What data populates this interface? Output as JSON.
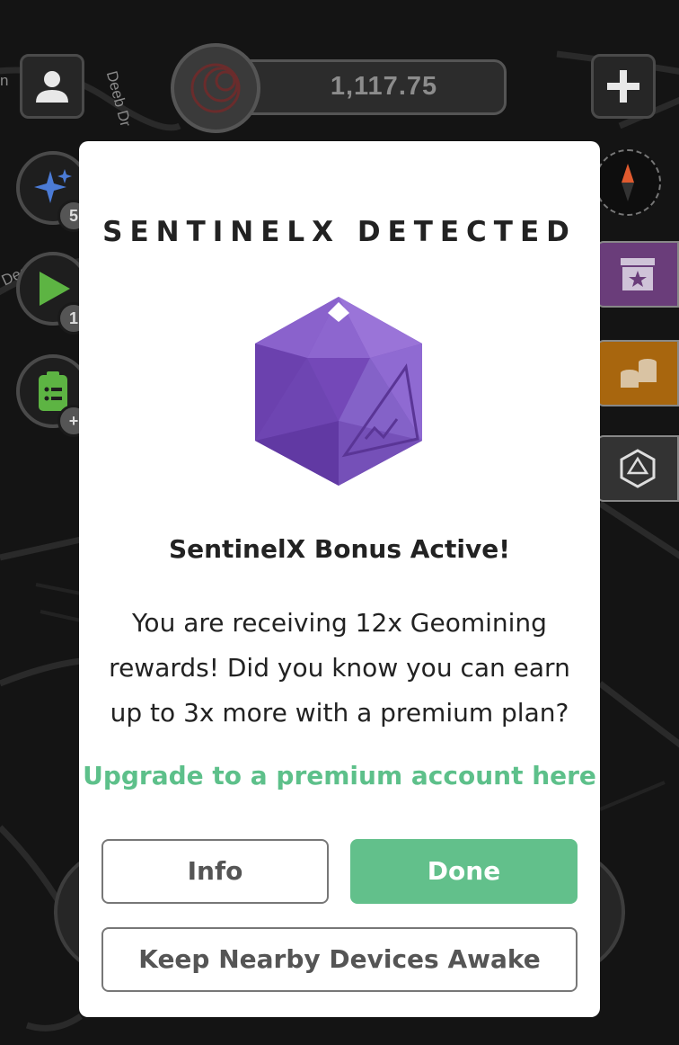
{
  "map": {
    "street_labels": [
      "n",
      "Deeb Dr",
      "Deeb Dr"
    ]
  },
  "hud": {
    "balance": "1,117.75",
    "left_badges": [
      "5",
      "1",
      "+"
    ]
  },
  "modal": {
    "title": "SENTINELX DETECTED",
    "subtitle": "SentinelX Bonus Active!",
    "body": "You are receiving 12x Geomining rewards! Did you know you can earn up to 3x more with a premium plan?",
    "upgrade_link": "Upgrade to a premium account here",
    "buttons": {
      "info": "Info",
      "done": "Done",
      "keep_awake": "Keep Nearby Devices Awake"
    }
  },
  "colors": {
    "accent_green": "#62c08b",
    "link_green": "#5dc08a",
    "gem_purple": "#7b4fc0",
    "background": "#141414"
  },
  "icons": [
    "profile-icon",
    "plus-icon",
    "sparkles-icon",
    "play-icon",
    "clipboard-icon",
    "compass-icon",
    "star-box-icon",
    "coins-icon",
    "dice-icon",
    "sentinelx-gem-icon"
  ]
}
